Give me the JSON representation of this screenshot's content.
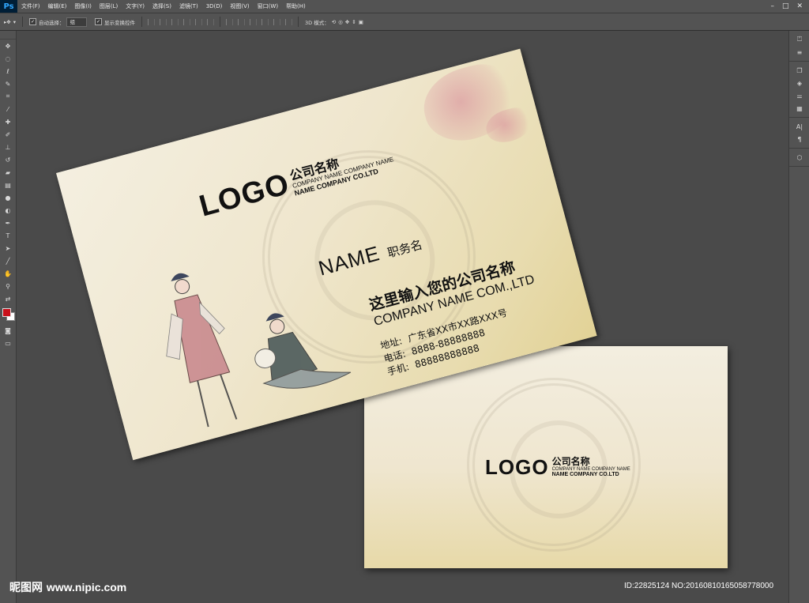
{
  "app": {
    "logo": "Ps",
    "menu": [
      "文件(F)",
      "编辑(E)",
      "图像(I)",
      "图层(L)",
      "文字(Y)",
      "选择(S)",
      "滤镜(T)",
      "3D(D)",
      "视图(V)",
      "窗口(W)",
      "帮助(H)"
    ],
    "window_controls": [
      "–",
      "□",
      "✕"
    ]
  },
  "options": {
    "auto_select_label": "自动选择：",
    "auto_select_value": "组",
    "show_transform_label": "显示变换控件",
    "mode_3d_label": "3D 模式："
  },
  "tools": [
    "move-tool",
    "marquee-tool",
    "lasso-tool",
    "quick-select-tool",
    "crop-tool",
    "eyedropper-tool",
    "healing-tool",
    "brush-tool",
    "clone-stamp-tool",
    "history-brush-tool",
    "eraser-tool",
    "gradient-tool",
    "blur-tool",
    "dodge-tool",
    "pen-tool",
    "type-tool",
    "path-select-tool",
    "shape-tool",
    "hand-tool",
    "zoom-tool"
  ],
  "colors": {
    "foreground": "#c8111b",
    "background": "#ffffff"
  },
  "front_card": {
    "logo": "LOGO",
    "company_cn": "公司名称",
    "company_en_1": "COMPANY NAME COMPANY NAME",
    "company_en_2": "NAME COMPANY CO.LTD",
    "name": "NAME",
    "job_title": "职务名",
    "company_full_cn": "这里输入您的公司名称",
    "company_full_en": "COMPANY NAME COM.,LTD",
    "address_label": "地址:",
    "address": "广东省XX市XX路XXX号",
    "phone_label": "电话:",
    "phone": "8888-88888888",
    "mobile_label": "手机:",
    "mobile": "88888888888"
  },
  "back_card": {
    "logo": "LOGO",
    "company_cn": "公司名称",
    "company_en_1": "COMPANY NAME COMPANY NAME",
    "company_en_2": "NAME COMPANY CO.LTD"
  },
  "watermark": {
    "brand": "昵图网",
    "site": "www.nipic.com",
    "id_text": "ID:22825124 NO:20160810165058778000"
  }
}
